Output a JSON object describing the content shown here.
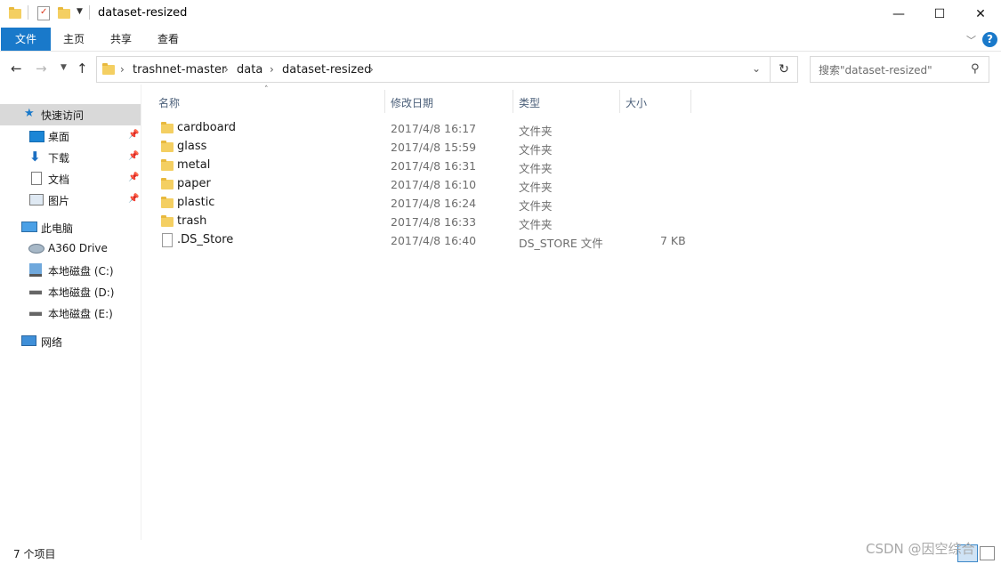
{
  "window": {
    "title": "dataset-resized",
    "minimize": "—",
    "maximize": "☐",
    "close": "✕"
  },
  "ribbon": {
    "tabs": [
      "文件",
      "主页",
      "共享",
      "查看"
    ]
  },
  "address": {
    "crumbs": [
      "trashnet-master",
      "data",
      "dataset-resized"
    ]
  },
  "search": {
    "placeholder": "搜索\"dataset-resized\""
  },
  "nav": {
    "quick_access": "快速访问",
    "pinned": [
      "桌面",
      "下载",
      "文档",
      "图片"
    ],
    "this_pc": "此电脑",
    "drives": [
      "A360 Drive",
      "本地磁盘 (C:)",
      "本地磁盘 (D:)",
      "本地磁盘 (E:)"
    ],
    "network": "网络"
  },
  "columns": {
    "name": "名称",
    "date": "修改日期",
    "type": "类型",
    "size": "大小"
  },
  "files": [
    {
      "name": "cardboard",
      "date": "2017/4/8 16:17",
      "type": "文件夹",
      "size": "",
      "icon": "folder-icon"
    },
    {
      "name": "glass",
      "date": "2017/4/8 15:59",
      "type": "文件夹",
      "size": "",
      "icon": "folder-icon"
    },
    {
      "name": "metal",
      "date": "2017/4/8 16:31",
      "type": "文件夹",
      "size": "",
      "icon": "folder-icon"
    },
    {
      "name": "paper",
      "date": "2017/4/8 16:10",
      "type": "文件夹",
      "size": "",
      "icon": "folder-icon"
    },
    {
      "name": "plastic",
      "date": "2017/4/8 16:24",
      "type": "文件夹",
      "size": "",
      "icon": "folder-icon"
    },
    {
      "name": "trash",
      "date": "2017/4/8 16:33",
      "type": "文件夹",
      "size": "",
      "icon": "folder-icon"
    },
    {
      "name": ".DS_Store",
      "date": "2017/4/8 16:40",
      "type": "DS_STORE 文件",
      "size": "7 KB",
      "icon": "file-icon"
    }
  ],
  "status": {
    "item_count": "7 个项目"
  },
  "watermark": "CSDN @因空综合",
  "colors": {
    "accent": "#1979ca",
    "folder": "#f4cf62",
    "selected_nav": "#d9d9d9"
  }
}
